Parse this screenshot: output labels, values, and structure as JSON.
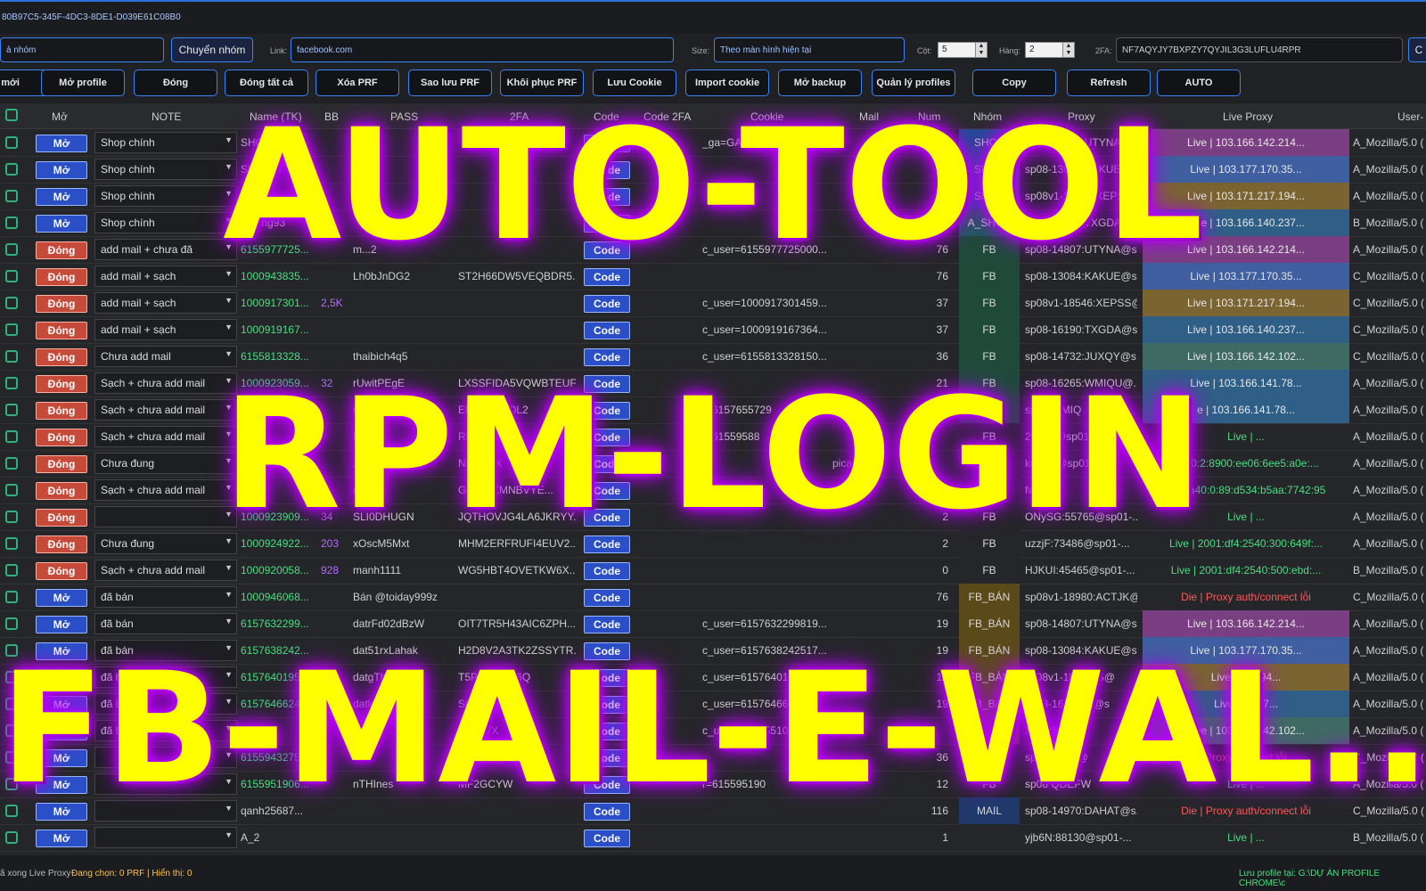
{
  "title_id": "80B97C5-345F-4DC3-8DE1-D039E61C08B0",
  "row1": {
    "group_value": "ả nhóm",
    "switch_group_label": "Chuyển nhóm",
    "link_label": "Link:",
    "link_value": "facebook.com",
    "size_label": "Size:",
    "size_value": "Theo màn hình hiện tại",
    "cols_label": "Cột:",
    "cols_value": "5",
    "rows_label": "Hàng:",
    "rows_value": "2",
    "twofa_label": "2FA:",
    "twofa_value": "NF7AQYJY7BXPZY7QYJIL3G3LUFLU4RPR",
    "right_btn": "C"
  },
  "toolbar": [
    "e mới",
    "Mở profile",
    "Đóng",
    "Đóng tất cả",
    "Xóa PRF",
    "Sao lưu PRF",
    "Khôi phục PRF",
    "Lưu Cookie",
    "Import cookie",
    "Mở backup",
    "Quản lý profiles",
    "Copy",
    "Refresh",
    "AUTO"
  ],
  "headers": {
    "mo": "Mở",
    "note": "NOTE",
    "name": "Name (TK)",
    "bb": "BB",
    "pass": "PASS",
    "twofa": "2FA",
    "code": "Code",
    "code2fa": "Code 2FA",
    "cookie": "Cookie",
    "mail": "Mail",
    "num": "Num",
    "nhom": "Nhóm",
    "proxy": "Proxy",
    "live_proxy": "Live Proxy",
    "useragent": "User-"
  },
  "rows": [
    {
      "btn": "Mở",
      "note": "Shop chính",
      "name": "SHOP_LIE",
      "bb": "",
      "pass": "",
      "twofa": "",
      "cookie": "_ga=GA1.1.558266843",
      "mail": "",
      "num": "20",
      "nhom": "SHOP",
      "nhom_c": "#1f4f8f",
      "proxy": "sp08-14807:UTYNA@s",
      "live": "Live | 103.166.142.214...",
      "live_c": "#7a3f82",
      "ua": "A_Mozilla/5.0 ("
    },
    {
      "btn": "Mở",
      "note": "Shop chính",
      "name": "SHOP_T",
      "bb": "",
      "pass": "",
      "twofa": "",
      "cookie": "",
      "mail": "",
      "num": "20",
      "nhom": "SHOP",
      "nhom_c": "#1f4f8f",
      "proxy": "sp08-13084:KAKUE@s",
      "live": "Live | 103.177.170.35...",
      "live_c": "#3f5fa0",
      "ua": "A_Mozilla/5.0 ("
    },
    {
      "btn": "Mở",
      "note": "Shop chính",
      "name": "SHOP",
      "bb": "",
      "pass": "",
      "twofa": "",
      "cookie": "",
      "mail": "",
      "num": "20",
      "nhom": "SHOP",
      "nhom_c": "#1f4f8f",
      "proxy": "sp08v1-18546:XEPSS@",
      "live": "Live | 103.171.217.194...",
      "live_c": "#7a6432",
      "ua": "A_Mozilla/5.0 ("
    },
    {
      "btn": "Mở",
      "note": "Shop chính",
      "name": "thuong93",
      "bb": "",
      "pass": "",
      "twofa": "",
      "cookie": "",
      "mail": "",
      "num": "",
      "nhom": "A_SHOP",
      "nhom_c": "#1f5a5a",
      "proxy": "sp08-16190:TXGDA@s",
      "live": "Live | 103.166.140.237...",
      "live_c": "#2f5f86",
      "ua": "B_Mozilla/5.0 ("
    },
    {
      "btn": "Đóng",
      "note": "add mail + chưa đă",
      "name": "6155977725...",
      "bb": "",
      "pass": "m...2",
      "twofa": "",
      "cookie": "c_user=6155977725000...",
      "mail": "",
      "num": "76",
      "nhom": "FB",
      "nhom_c": "#1f4a3a",
      "proxy": "sp08-14807:UTYNA@s...",
      "live": "Live | 103.166.142.214...",
      "live_c": "#7a3f82",
      "ua": "A_Mozilla/5.0 ("
    },
    {
      "btn": "Đóng",
      "note": "add mail + sạch",
      "name": "1000943835...",
      "bb": "",
      "pass": "Lh0bJnDG2",
      "twofa": "ST2H66DW5VEQBDR5...",
      "cookie": "",
      "mail": "",
      "num": "76",
      "nhom": "FB",
      "nhom_c": "#1f4a3a",
      "proxy": "sp08-13084:KAKUE@s...",
      "live": "Live | 103.177.170.35...",
      "live_c": "#3f5fa0",
      "ua": "C_Mozilla/5.0 ("
    },
    {
      "btn": "Đóng",
      "note": "add mail + sạch",
      "name": "1000917301...",
      "bb": "2,5K",
      "pass": "",
      "twofa": "",
      "cookie": "c_user=1000917301459...",
      "mail": "",
      "num": "37",
      "nhom": "FB",
      "nhom_c": "#1f4a3a",
      "proxy": "sp08v1-18546:XEPSS@...",
      "live": "Live | 103.171.217.194...",
      "live_c": "#7a6432",
      "ua": "C_Mozilla/5.0 ("
    },
    {
      "btn": "Đóng",
      "note": "add mail + sạch",
      "name": "1000919167...",
      "bb": "",
      "pass": "",
      "twofa": "",
      "cookie": "c_user=1000919167364...",
      "mail": "",
      "num": "37",
      "nhom": "FB",
      "nhom_c": "#1f4a3a",
      "proxy": "sp08-16190:TXGDA@s...",
      "live": "Live | 103.166.140.237...",
      "live_c": "#2f5f86",
      "ua": "C_Mozilla/5.0 ("
    },
    {
      "btn": "Đóng",
      "note": "Chưa add mail",
      "name": "6155813328...",
      "bb": "",
      "pass": "thaibich4q5",
      "twofa": "",
      "cookie": "c_user=6155813328150...",
      "mail": "",
      "num": "36",
      "nhom": "FB",
      "nhom_c": "#1f4a3a",
      "proxy": "sp08-14732:JUXQY@s...",
      "live": "Live | 103.166.142.102...",
      "live_c": "#3f6a64",
      "ua": "C_Mozilla/5.0 ("
    },
    {
      "btn": "Đóng",
      "note": "Sạch + chưa add mail",
      "name": "1000923059...",
      "bb": "32",
      "pass": "rUwitPEgE",
      "twofa": "LXSSFIDA5VQWBTEUF...",
      "cookie": "",
      "mail": "",
      "num": "21",
      "nhom": "FB",
      "nhom_c": "#1f4a3a",
      "proxy": "sp08-16265:WMIQU@...",
      "live": "Live | 103.166.141.78...",
      "live_c": "#2f5f86",
      "ua": "A_Mozilla/5.0 ("
    },
    {
      "btn": "Đóng",
      "note": "Sạch + chưa add mail",
      "name": "6157",
      "bb": "",
      "pass": "datZj",
      "twofa": "EHLR 6SLDL2",
      "cookie": "r=6157655729",
      "mail": "",
      "num": "",
      "nhom": "FB",
      "nhom_c": "#1f4a3a",
      "proxy": "sp08 WMIQ",
      "live": "e | 103.166.141.78...",
      "live_c": "#2f5f86",
      "ua": "A_Mozilla/5.0 ("
    },
    {
      "btn": "Đóng",
      "note": "Sạch + chưa add mail",
      "name": "6155",
      "bb": "",
      "pass": "K59tn",
      "twofa": "RK",
      "cookie": "r=61559588",
      "mail": "",
      "num": "",
      "nhom": "FB",
      "nhom_c": "#252629",
      "proxy": "2Phi 4@sp01",
      "live": "Live | ...",
      "live_c": "",
      "ua": "A_Mozilla/5.0 ("
    },
    {
      "btn": "Đóng",
      "note": "Chưa đung",
      "name": "6157",
      "bb": "",
      "pass": "29YEc",
      "twofa": "NF7A BX",
      "cookie": "",
      "mail": "picarc",
      "num": "",
      "nhom": "",
      "nhom_c": "#252629",
      "proxy": "krR1 5@sp01",
      "live": "5a40:2:8900:ee06:6ee5:a0e:...",
      "live_c": "",
      "ua": "A_Mozilla/5.0 ("
    },
    {
      "btn": "Đóng",
      "note": "Sạch + chưa add mail",
      "name": "1000",
      "bb": "",
      "pass": "manh",
      "twofa": "G3PIB ZMNBVYE...",
      "cookie": "",
      "mail": "",
      "num": "",
      "nhom": "",
      "nhom_c": "#252629",
      "proxy": "fwi",
      "live": "Liv 5a40:0:89:d534:b5aa:7742:95",
      "live_c": "",
      "ua": "A_Mozilla/5.0 ("
    },
    {
      "btn": "Đóng",
      "note": "",
      "name": "1000923909...",
      "bb": "34",
      "pass": "SLI0DHUGN",
      "twofa": "JQTHOVJG4LA6JKRYY...",
      "cookie": "",
      "mail": "",
      "num": "2",
      "nhom": "FB",
      "nhom_c": "#252629",
      "proxy": "ONySG:55765@sp01-...",
      "live": "Live | ...",
      "live_c": "",
      "ua": "A_Mozilla/5.0 ("
    },
    {
      "btn": "Đóng",
      "note": "Chưa đung",
      "name": "1000924922...",
      "bb": "203",
      "pass": "xOscM5Mxt",
      "twofa": "MHM2ERFRUFI4EUV2...",
      "cookie": "",
      "mail": "",
      "num": "2",
      "nhom": "FB",
      "nhom_c": "#252629",
      "proxy": "uzzjF:73486@sp01-...",
      "live": "Live | 2001:df4:2540:300:649f:...",
      "live_c": "",
      "ua": "A_Mozilla/5.0 ("
    },
    {
      "btn": "Đóng",
      "note": "Sạch + chưa add mail",
      "name": "1000920058...",
      "bb": "928",
      "pass": "manh1111",
      "twofa": "WG5HBT4OVETKW6X...",
      "cookie": "",
      "mail": "",
      "num": "0",
      "nhom": "FB",
      "nhom_c": "#252629",
      "proxy": "HJKUI:45465@sp01-...",
      "live": "Live | 2001:df4:2540:500:ebd:...",
      "live_c": "",
      "ua": "B_Mozilla/5.0 ("
    },
    {
      "btn": "Mở",
      "note": "đã bán",
      "name": "1000946068...",
      "bb": "",
      "pass": "Bán @toiday999z",
      "twofa": "",
      "cookie": "",
      "mail": "",
      "num": "76",
      "nhom": "FB_BÁN",
      "nhom_c": "#5a4a1a",
      "proxy": "sp08v1-18980:ACTJK@...",
      "live": "Die | Proxy auth/connect lỗi",
      "live_c": "",
      "ua": "C_Mozilla/5.0 ("
    },
    {
      "btn": "Mở",
      "note": "đã bán",
      "name": "6157632299...",
      "bb": "",
      "pass": "datrFd02dBzW",
      "twofa": "OIT7TR5H43AIC6ZPH...",
      "cookie": "c_user=6157632299819...",
      "mail": "",
      "num": "19",
      "nhom": "FB_BÁN",
      "nhom_c": "#5a4a1a",
      "proxy": "sp08-14807:UTYNA@s...",
      "live": "Live | 103.166.142.214...",
      "live_c": "#7a3f82",
      "ua": "A_Mozilla/5.0 ("
    },
    {
      "btn": "Mở",
      "note": "đã bán",
      "name": "6157638242...",
      "bb": "",
      "pass": "dat51rxLahak",
      "twofa": "H2D8V2A3TK2ZSSYTR...",
      "cookie": "c_user=6157638242517...",
      "mail": "",
      "num": "19",
      "nhom": "FB_BÁN",
      "nhom_c": "#5a4a1a",
      "proxy": "sp08-13084:KAKUE@s...",
      "live": "Live | 103.177.170.35...",
      "live_c": "#3f5fa0",
      "ua": "A_Mozilla/5.0 ("
    },
    {
      "btn": "Mở",
      "note": "đã bá",
      "name": "6157640195...",
      "bb": "",
      "pass": "datgTh",
      "twofa": "T5P U4BNP6Q",
      "cookie": "c_user=61576401",
      "mail": "",
      "num": "19",
      "nhom": "FB_BÁN",
      "nhom_c": "#5a4a1a",
      "proxy": "sp08v1-1854 SS@",
      "live": "Live | 10 194...",
      "live_c": "#7a6432",
      "ua": "A_Mozilla/5.0 ("
    },
    {
      "btn": "Mở",
      "note": "đã bá",
      "name": "6157646624...",
      "bb": "",
      "pass": "datk",
      "twofa": "SG3W7P",
      "cookie": "c_user=61576466",
      "mail": "",
      "num": "19",
      "nhom": "FB_BÁN",
      "nhom_c": "#5a4a1a",
      "proxy": "sp08-1619 DA@s",
      "live": "Live | 1 237...",
      "live_c": "#2f5f86",
      "ua": "A_Mozilla/5.0 ("
    },
    {
      "btn": "Mở",
      "note": "đã bá",
      "name": "102...",
      "bb": "",
      "pass": "",
      "twofa": "R56ZVX",
      "cookie": "c_user=61555510",
      "mail": "",
      "num": "",
      "nhom": "",
      "nhom_c": "#5a4a1a",
      "proxy": "XQY@s",
      "live": "Live | 103.166.142.102...",
      "live_c": "#3f6a64",
      "ua": "A_Mozilla/5.0 ("
    },
    {
      "btn": "Mở",
      "note": "",
      "name": "6155943275...",
      "bb": "",
      "pass": "",
      "twofa": "",
      "cookie": "",
      "mail": "",
      "num": "36",
      "nhom": "",
      "nhom_c": "#252629",
      "proxy": "sp0 EWRB@",
      "live": "Proxy connect lỗi",
      "live_c": "",
      "ua": "C_Mozilla/5.0 ("
    },
    {
      "btn": "Mở",
      "note": "",
      "name": "6155951906...",
      "bb": "",
      "pass": "nTHInes",
      "twofa": "MF2GCYW",
      "cookie": "r=615595190",
      "mail": "",
      "num": "12",
      "nhom": "FB",
      "nhom_c": "#252629",
      "proxy": "sp08 QDEFW",
      "live": "Live | ...",
      "live_c": "",
      "ua": "A_Mozilla/5.0 ("
    },
    {
      "btn": "Mở",
      "note": "",
      "name": "qanh25687...",
      "bb": "",
      "pass": "",
      "twofa": "",
      "cookie": "",
      "mail": "",
      "num": "116",
      "nhom": "MAIL",
      "nhom_c": "#1f3a6a",
      "proxy": "sp08-14970:DAHAT@s...",
      "live": "Die | Proxy auth/connect lỗi",
      "live_c": "",
      "ua": "C_Mozilla/5.0 ("
    },
    {
      "btn": "Mở",
      "note": "",
      "name": "A_2",
      "bb": "",
      "pass": "",
      "twofa": "",
      "cookie": "",
      "mail": "",
      "num": "1",
      "nhom": "",
      "nhom_c": "#252629",
      "proxy": "yjb6N:88130@sp01-...",
      "live": "Live | ...",
      "live_c": "",
      "ua": "B_Mozilla/5.0 ("
    }
  ],
  "code_label": "Code",
  "status": {
    "left": "ã xong Live Proxy",
    "selected": "Đang chọn: 0 PRF | Hiển thị: 0",
    "right": "Lưu profile tại: G:\\DỰ ÁN PROFILE CHROME\\c"
  },
  "overlay": [
    "AUTO-TOOL",
    "RPM-LOGIN",
    "FB-MAIL-E-WAL.."
  ]
}
